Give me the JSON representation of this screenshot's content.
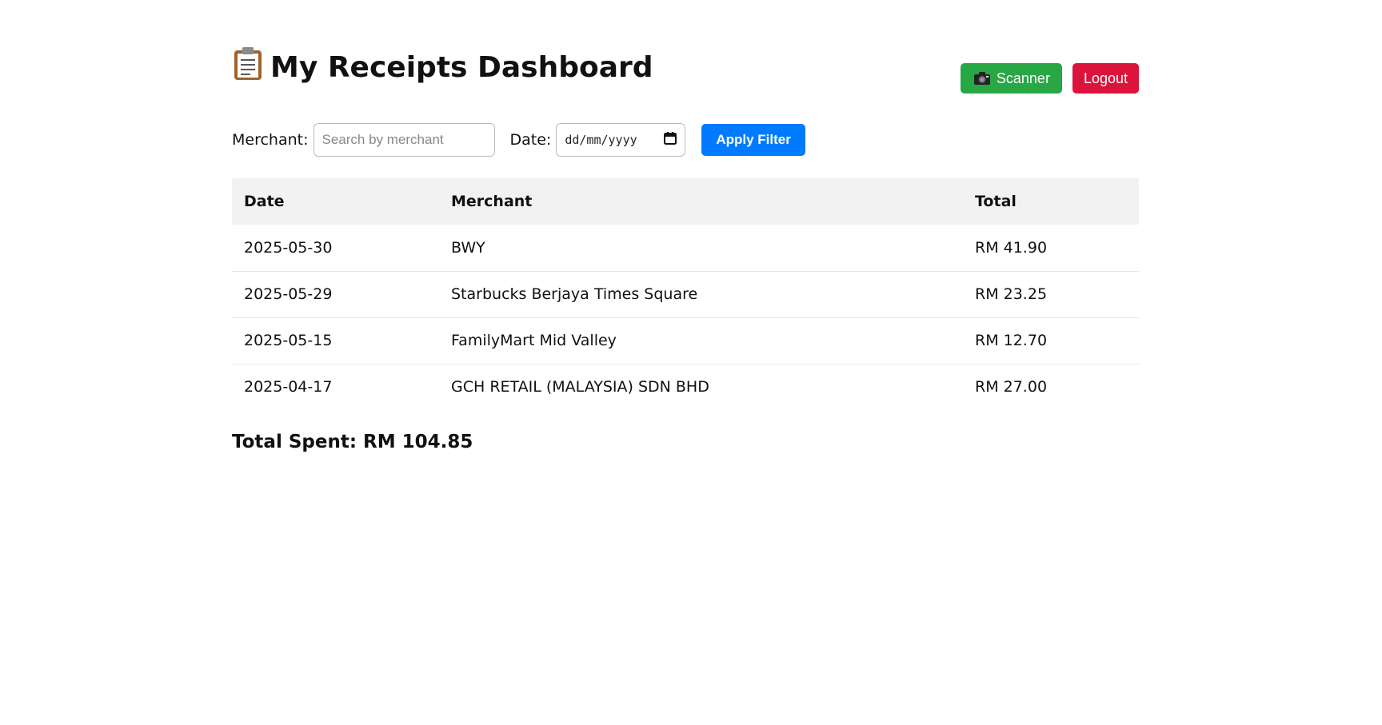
{
  "header": {
    "title": "My Receipts Dashboard",
    "scanner_label": "Scanner",
    "logout_label": "Logout"
  },
  "filters": {
    "merchant_label": "Merchant:",
    "merchant_placeholder": "Search by merchant",
    "date_label": "Date:",
    "date_placeholder": "dd/mm/yyyy",
    "apply_label": "Apply Filter"
  },
  "table": {
    "headers": [
      "Date",
      "Merchant",
      "Total"
    ],
    "rows": [
      [
        "2025-05-30",
        "BWY",
        "RM 41.90"
      ],
      [
        "2025-05-29",
        "Starbucks Berjaya Times Square",
        "RM 23.25"
      ],
      [
        "2025-05-15",
        "FamilyMart Mid Valley",
        "RM 12.70"
      ],
      [
        "2025-04-17",
        "GCH RETAIL (MALAYSIA) SDN BHD",
        "RM 27.00"
      ]
    ]
  },
  "summary": {
    "total_text": "Total Spent: RM 104.85"
  },
  "colors": {
    "scanner": "#28a745",
    "logout": "#dc143c",
    "apply": "#007bff",
    "table_header": "#f2f2f2"
  },
  "icons": {
    "title_icon": "clipboard-icon",
    "scanner_icon": "camera-icon",
    "date_icon": "calendar-icon"
  }
}
